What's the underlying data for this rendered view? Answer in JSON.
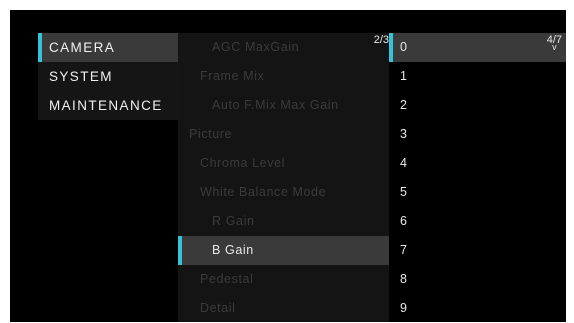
{
  "colors": {
    "accent": "#35c3d9",
    "selected_bg": "#3a3a3a",
    "text": "#e8e8e8",
    "dim_text": "#3b3b3b"
  },
  "main_menu": {
    "items": [
      {
        "label": "CAMERA",
        "selected": true
      },
      {
        "label": "SYSTEM",
        "selected": false
      },
      {
        "label": "MAINTENANCE",
        "selected": false
      }
    ]
  },
  "sub_menu": {
    "page_indicator": "2/3",
    "items": [
      {
        "label": "AGC MaxGain"
      },
      {
        "label": "Frame Mix"
      },
      {
        "label": "Auto F.Mix Max Gain"
      },
      {
        "label": "Picture"
      },
      {
        "label": "Chroma Level"
      },
      {
        "label": "White Balance Mode"
      },
      {
        "label": "R Gain"
      },
      {
        "label": "B Gain"
      },
      {
        "label": "Pedestal"
      },
      {
        "label": "Detail"
      }
    ]
  },
  "value_list": {
    "page_indicator": "4/7",
    "scroll_icon": "down-arrow",
    "scroll_glyph": "v",
    "items": [
      "0",
      "1",
      "2",
      "3",
      "4",
      "5",
      "6",
      "7",
      "8",
      "9"
    ]
  }
}
